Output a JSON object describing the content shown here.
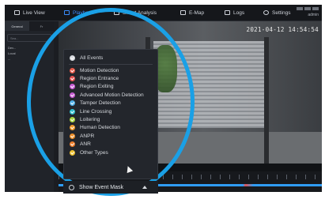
{
  "nav": {
    "items": [
      {
        "label": "Live View",
        "icon": "monitor-icon"
      },
      {
        "label": "Playback",
        "icon": "playback-icon",
        "active": true
      },
      {
        "label": "Smart Analysis",
        "icon": "chart-icon"
      },
      {
        "label": "E-Map",
        "icon": "map-icon"
      },
      {
        "label": "Logs",
        "icon": "log-icon"
      },
      {
        "label": "Settings",
        "icon": "gear-icon"
      }
    ],
    "user": "admin"
  },
  "left_panel": {
    "tabs": [
      "General",
      "Fr"
    ],
    "search_placeholder": "Sea...",
    "tree": [
      "Dev...",
      "Local",
      "..."
    ]
  },
  "video": {
    "timestamp": "2021-04-12 14:54:54"
  },
  "menu": {
    "all": {
      "label": "All Events",
      "color": "#d6d9de"
    },
    "items": [
      {
        "label": "Motion Detection",
        "color": "#e65a4a"
      },
      {
        "label": "Region Entrance",
        "color": "#e2514f"
      },
      {
        "label": "Region Exiting",
        "color": "#c95cd6"
      },
      {
        "label": "Advanced Motion Detection",
        "color": "#c65bd1"
      },
      {
        "label": "Tamper Detection",
        "color": "#4fb0e8"
      },
      {
        "label": "Line Crossing",
        "color": "#2fbfd0"
      },
      {
        "label": "Loitering",
        "color": "#a7d23e"
      },
      {
        "label": "Human Detection",
        "color": "#ef9a2a"
      },
      {
        "label": "ANPR",
        "color": "#ee8f29"
      },
      {
        "label": "ANR",
        "color": "#ee7d2b"
      },
      {
        "label": "Other Types",
        "color": "#efc22e"
      }
    ],
    "show_event_mask": "Show Event Mask"
  }
}
